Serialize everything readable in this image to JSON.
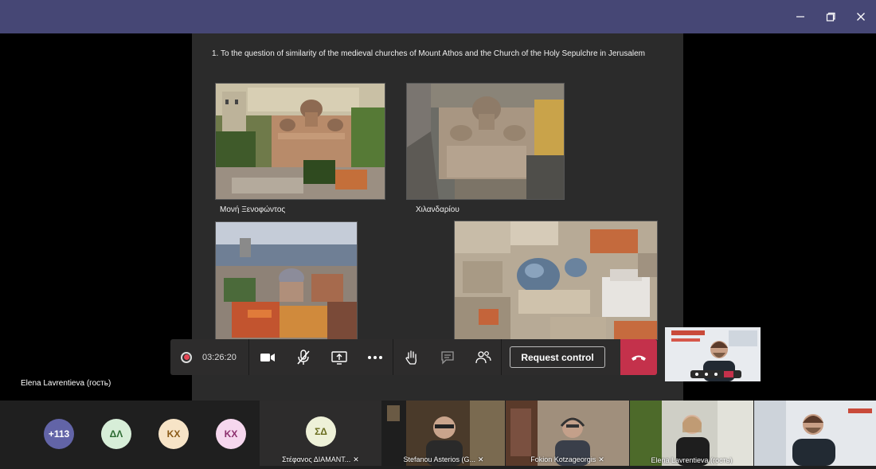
{
  "window": {
    "minimize_icon": "minimize-icon",
    "maximize_icon": "maximize-icon",
    "close_icon": "close-icon"
  },
  "slide": {
    "title": "1. To the question of similarity of the medieval churches of Mount Athos and the Church of the Holy Sepulchre in Jerusalem",
    "photos": [
      {
        "caption": "Μονή Ξενοφώντος"
      },
      {
        "caption": "Χιλανδαρίου"
      }
    ]
  },
  "stage": {
    "presenter_name": "Elena Lavrentieva (гость)"
  },
  "controls": {
    "timer": "03:26:20",
    "request_control_label": "Request control",
    "icons": [
      "record-icon",
      "camera-icon",
      "mic-off-icon",
      "share-screen-icon",
      "more-icon",
      "raise-hand-icon",
      "chat-icon",
      "participants-icon",
      "hang-up-icon"
    ]
  },
  "gallery": {
    "overflow_count": "+113",
    "avatars": [
      {
        "initials": "ΔΛ",
        "color": "#d7eed8",
        "text_color": "#2b6a31"
      },
      {
        "initials": "ΚΧ",
        "color": "#f7e4c7",
        "text_color": "#8a5a17"
      },
      {
        "initials": "ΚΧ",
        "color": "#f6d7ee",
        "text_color": "#8c2f6d"
      }
    ],
    "tiles": [
      {
        "initials": "ΣΔ",
        "name": "Στέφανος ΔΙΑΜΑΝΤ..."
      },
      {
        "name": "Stefanou Asterios (G..."
      },
      {
        "name": "Fokion Kotzageorgis"
      },
      {
        "name": "Elena Lavrentieva (гость)"
      }
    ]
  },
  "colors": {
    "titlebar": "#464775",
    "overflow_avatar": "#6264a7",
    "hangup": "#c4314b"
  }
}
